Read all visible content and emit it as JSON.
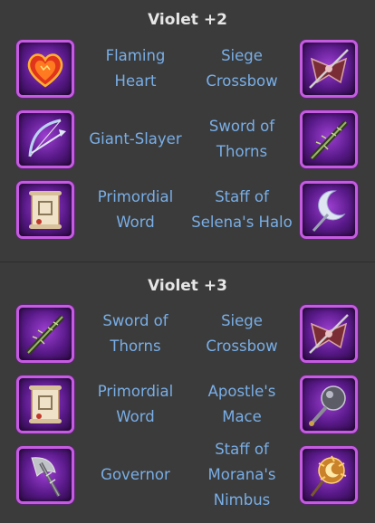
{
  "sections": [
    {
      "title": "Violet +2",
      "rows": [
        {
          "left": {
            "name": "Flaming Heart",
            "lines": [
              "Flaming",
              "Heart"
            ],
            "icon": "flaming-heart-icon"
          },
          "right": {
            "name": "Siege Crossbow",
            "lines": [
              "Siege",
              "Crossbow"
            ],
            "icon": "siege-crossbow-icon"
          }
        },
        {
          "left": {
            "name": "Giant-Slayer",
            "lines": [
              "Giant-Slayer"
            ],
            "icon": "giant-slayer-bow-icon"
          },
          "right": {
            "name": "Sword of Thorns",
            "lines": [
              "Sword of",
              "Thorns"
            ],
            "icon": "sword-of-thorns-icon"
          }
        },
        {
          "left": {
            "name": "Primordial Word",
            "lines": [
              "Primordial",
              "Word"
            ],
            "icon": "primordial-word-scroll-icon"
          },
          "right": {
            "name": "Staff of Selena's Halo",
            "lines": [
              "Staff of",
              "Selena's Halo"
            ],
            "icon": "staff-of-selenas-halo-icon"
          }
        }
      ]
    },
    {
      "title": "Violet +3",
      "rows": [
        {
          "left": {
            "name": "Sword of Thorns",
            "lines": [
              "Sword of",
              "Thorns"
            ],
            "icon": "sword-of-thorns-icon"
          },
          "right": {
            "name": "Siege Crossbow",
            "lines": [
              "Siege",
              "Crossbow"
            ],
            "icon": "siege-crossbow-icon"
          }
        },
        {
          "left": {
            "name": "Primordial Word",
            "lines": [
              "Primordial",
              "Word"
            ],
            "icon": "primordial-word-scroll-icon"
          },
          "right": {
            "name": "Apostle's Mace",
            "lines": [
              "Apostle's",
              "Mace"
            ],
            "icon": "apostles-mace-icon"
          }
        },
        {
          "left": {
            "name": "Governor",
            "lines": [
              "Governor"
            ],
            "icon": "governor-axe-icon"
          },
          "right": {
            "name": "Staff of Morana's Nimbus",
            "lines": [
              "Staff of",
              "Morana's",
              "Nimbus"
            ],
            "icon": "staff-of-moranas-nimbus-icon"
          }
        }
      ]
    }
  ],
  "colors": {
    "background": "#3b3b3b",
    "title": "#e6e6e6",
    "link": "#79aee6",
    "frame": "#c55be0"
  }
}
